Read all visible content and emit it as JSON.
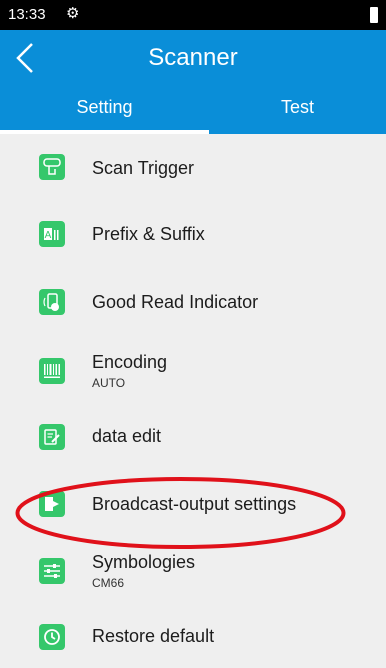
{
  "status_bar": {
    "time": "13:33",
    "icons": [
      "gear-icon",
      "battery-icon"
    ]
  },
  "app_bar": {
    "title": "Scanner",
    "back_icon": "chevron-left-icon"
  },
  "tabs": [
    {
      "label": "Setting",
      "selected": true
    },
    {
      "label": "Test",
      "selected": false
    }
  ],
  "menu": {
    "items": [
      {
        "label": "Scan Trigger",
        "sub": "",
        "icon": "scan-trigger-icon"
      },
      {
        "label": "Prefix & Suffix",
        "sub": "",
        "icon": "prefix-suffix-icon"
      },
      {
        "label": "Good Read Indicator",
        "sub": "",
        "icon": "good-read-indicator-icon"
      },
      {
        "label": "Encoding",
        "sub": "AUTO",
        "icon": "barcode-encoding-icon"
      },
      {
        "label": "data edit",
        "sub": "",
        "icon": "edit-document-icon"
      },
      {
        "label": "Broadcast-output settings",
        "sub": "",
        "icon": "broadcast-output-icon"
      },
      {
        "label": "Symbologies",
        "sub": "CM66",
        "icon": "sliders-icon"
      },
      {
        "label": "Restore default",
        "sub": "",
        "icon": "clock-restore-icon"
      }
    ]
  },
  "annotation": {
    "highlighted_item": "Broadcast-output settings",
    "color": "#e0111a"
  },
  "colors": {
    "primary": "#0a8ed8",
    "icon_green": "#35c76b",
    "background": "#efefef"
  }
}
